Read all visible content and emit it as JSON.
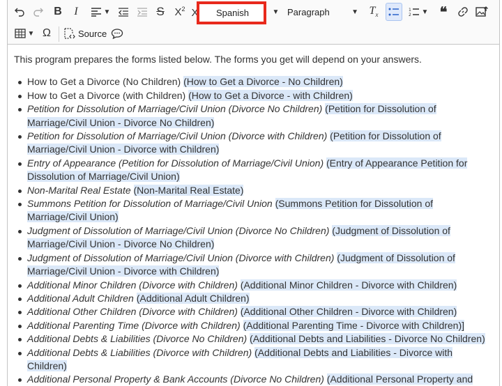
{
  "toolbar": {
    "language_value": "Spanish",
    "paragraph_value": "Paragraph",
    "source_label": "Source"
  },
  "content": {
    "intro": "This program prepares the forms listed below. The forms you get will depend on your answers.",
    "items": [
      {
        "label": "How to Get a Divorce (No Children)",
        "italic": false,
        "translation": "(How to Get a Divorce - No Children)"
      },
      {
        "label": "How to Get a Divorce (with Children)",
        "italic": false,
        "translation": "(How to Get a Divorce - with Children)"
      },
      {
        "label": "Petition for Dissolution of Marriage/Civil Union (Divorce No Children)",
        "italic": true,
        "translation": "(Petition for Dissolution of Marriage/Civil Union - Divorce No Children)"
      },
      {
        "label": "Petition for Dissolution of Marriage/Civil Union (Divorce with Children)",
        "italic": true,
        "translation": "(Petition for Dissolution of Marriage/Civil Union - Divorce with Children)"
      },
      {
        "label": "Entry of Appearance (Petition for Dissolution of Marriage/Civil Union)",
        "italic": true,
        "translation": "(Entry of Appearance Petition for Dissolution of Marriage/Civil Union)"
      },
      {
        "label": "Non-Marital Real Estate",
        "italic": true,
        "translation": "(Non-Marital Real Estate)"
      },
      {
        "label": "Summons Petition for Dissolution of Marriage/Civil Union",
        "italic": true,
        "translation": "(Summons Petition for Dissolution of Marriage/Civil Union)"
      },
      {
        "label": "Judgment of Dissolution of Marriage/Civil Union (Divorce No Children)",
        "italic": true,
        "translation": "(Judgment of Dissolution of Marriage/Civil Union - Divorce No Children)"
      },
      {
        "label": "Judgment of Dissolution of Marriage/Civil Union (Divorce with Children)",
        "italic": true,
        "translation": "(Judgment of Dissolution of Marriage/Civil Union - Divorce with Children)"
      },
      {
        "label": "Additional Minor Children (Divorce with Children)",
        "italic": true,
        "translation": "(Additional Minor Children - Divorce with Children)"
      },
      {
        "label": "Additional Adult Children",
        "italic": true,
        "translation": "(Additional Adult Children)"
      },
      {
        "label": "Additional Other Children (Divorce with Children)",
        "italic": true,
        "translation": "(Additional Other Children - Divorce with Children)"
      },
      {
        "label": "Additional Parenting Time (Divorce with Children)",
        "italic": true,
        "translation": "(Additional Parenting Time - Divorce with Children)]"
      },
      {
        "label": "Additional Debts & Liabilities (Divorce No Children)",
        "italic": true,
        "translation": "(Additional Debts and Liabilities - Divorce No Children)"
      },
      {
        "label": "Additional Debts & Liabilities (Divorce with Children)",
        "italic": true,
        "translation": "(Additional Debts and Liabilities - Divorce with Children)"
      },
      {
        "label": "Additional Personal Property & Bank Accounts (Divorce No Children)",
        "italic": true,
        "translation": "(Additional Personal Property and Bank Accounts - Divorce No Children)"
      }
    ]
  }
}
